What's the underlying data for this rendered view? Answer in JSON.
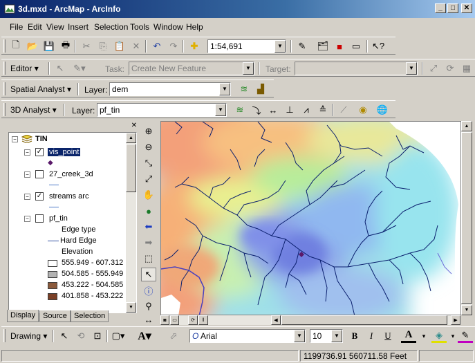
{
  "window": {
    "title": "3d.mxd - ArcMap - ArcInfo"
  },
  "menu": [
    "File",
    "Edit",
    "View",
    "Insert",
    "Selection",
    "Tools",
    "Window",
    "Help"
  ],
  "standard_toolbar": {
    "scale": "1:54,691"
  },
  "editor_toolbar": {
    "editor_label": "Editor",
    "task_label": "Task:",
    "task_value": "Create New Feature",
    "target_label": "Target:",
    "target_value": ""
  },
  "spatial_analyst": {
    "label": "Spatial Analyst",
    "layer_label": "Layer:",
    "layer_value": "dem"
  },
  "analyst_3d": {
    "label": "3D Analyst",
    "layer_label": "Layer:",
    "layer_value": "pf_tin"
  },
  "toc": {
    "root": "TIN",
    "layers": [
      {
        "name": "vis_point",
        "checked": true,
        "selected": true
      },
      {
        "name": "27_creek_3d",
        "checked": false
      },
      {
        "name": "streams arc",
        "checked": true
      },
      {
        "name": "pf_tin",
        "checked": false
      }
    ],
    "pf_tin_legend": {
      "edge_type": "Edge type",
      "hard_edge": "Hard Edge",
      "elevation": "Elevation",
      "classes": [
        {
          "label": "555.949 - 607.312",
          "color": "#ffffff"
        },
        {
          "label": "504.585 - 555.949",
          "color": "#b3b3b3"
        },
        {
          "label": "453.222 - 504.585",
          "color": "#8b5a3c"
        },
        {
          "label": "401.858 - 453.222",
          "color": "#7a3f26"
        }
      ]
    },
    "tabs": [
      "Display",
      "Source",
      "Selection"
    ]
  },
  "drawing_toolbar": {
    "label": "Drawing",
    "font": "Arial",
    "size": "10",
    "bold": "B",
    "italic": "I",
    "underline": "U",
    "font_color": "A"
  },
  "status": {
    "coords": "1199736.91  560711.58 Feet"
  },
  "colors": {
    "title_start": "#0a246a",
    "title_end": "#a6caf0",
    "stream": "#0a1f6e",
    "vis_point": "#5a1a6a"
  }
}
